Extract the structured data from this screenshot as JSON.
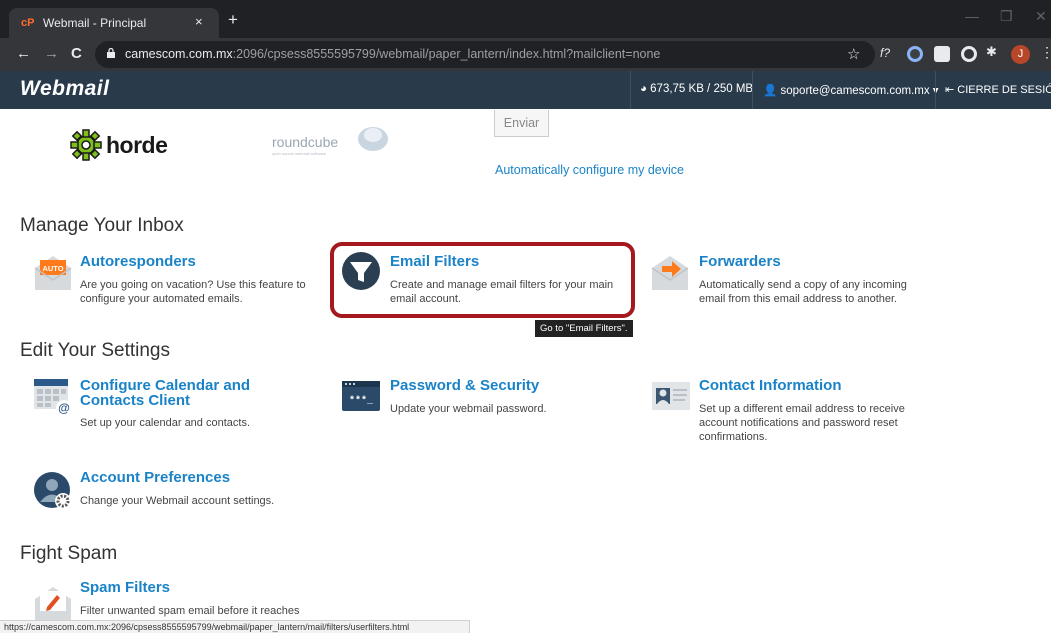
{
  "browser": {
    "tab_title": "Webmail - Principal",
    "tab_close": "×",
    "new_tab": "+",
    "url_host": "camescom.com.mx",
    "url_rest": ":2096/cpsess8555595799/webmail/paper_lantern/index.html?mailclient=none",
    "profile_initial": "J"
  },
  "header": {
    "logo": "Webmail",
    "quota": "673,75 KB / 250 MB",
    "user": "soporte@camescom.com.mx",
    "logout": "CIERRE DE SESIÓN"
  },
  "clients": {
    "horde": "horde",
    "roundcube": "roundcube",
    "roundcube_sub": "open source webmail software",
    "send_label": "Enviar",
    "auto_config": "Automatically configure my device"
  },
  "sections": {
    "inbox": "Manage Your Inbox",
    "settings": "Edit Your Settings",
    "spam": "Fight Spam"
  },
  "items": {
    "autoresponders": {
      "title": "Autoresponders",
      "desc": "Are you going on vacation? Use this feature to configure your automated emails.",
      "icon_label": "AUTO"
    },
    "email_filters": {
      "title": "Email Filters",
      "desc": "Create and manage email filters for your main email account."
    },
    "forwarders": {
      "title": "Forwarders",
      "desc": "Automatically send a copy of any incoming email from this email address to another."
    },
    "calendar": {
      "title_line1": "Configure Calendar and",
      "title_line2": "Contacts Client",
      "desc": "Set up your calendar and contacts."
    },
    "password": {
      "title": "Password & Security",
      "desc": "Update your webmail password.",
      "icon_label": "***_"
    },
    "contact": {
      "title": "Contact Information",
      "desc": "Set up a different email address to receive account notifications and password reset confirmations."
    },
    "preferences": {
      "title": "Account Preferences",
      "desc": "Change your Webmail account settings."
    },
    "spam_filters": {
      "title": "Spam Filters",
      "desc": "Filter unwanted spam email before it reaches"
    }
  },
  "tooltip": "Go to \"Email Filters\".",
  "status_url": "https://camescom.com.mx:2096/cpsess8555595799/webmail/paper_lantern/mail/filters/userfilters.html",
  "colors": {
    "link": "#1a83c8",
    "header_bg": "#293a4a",
    "highlight": "#a4181e"
  }
}
